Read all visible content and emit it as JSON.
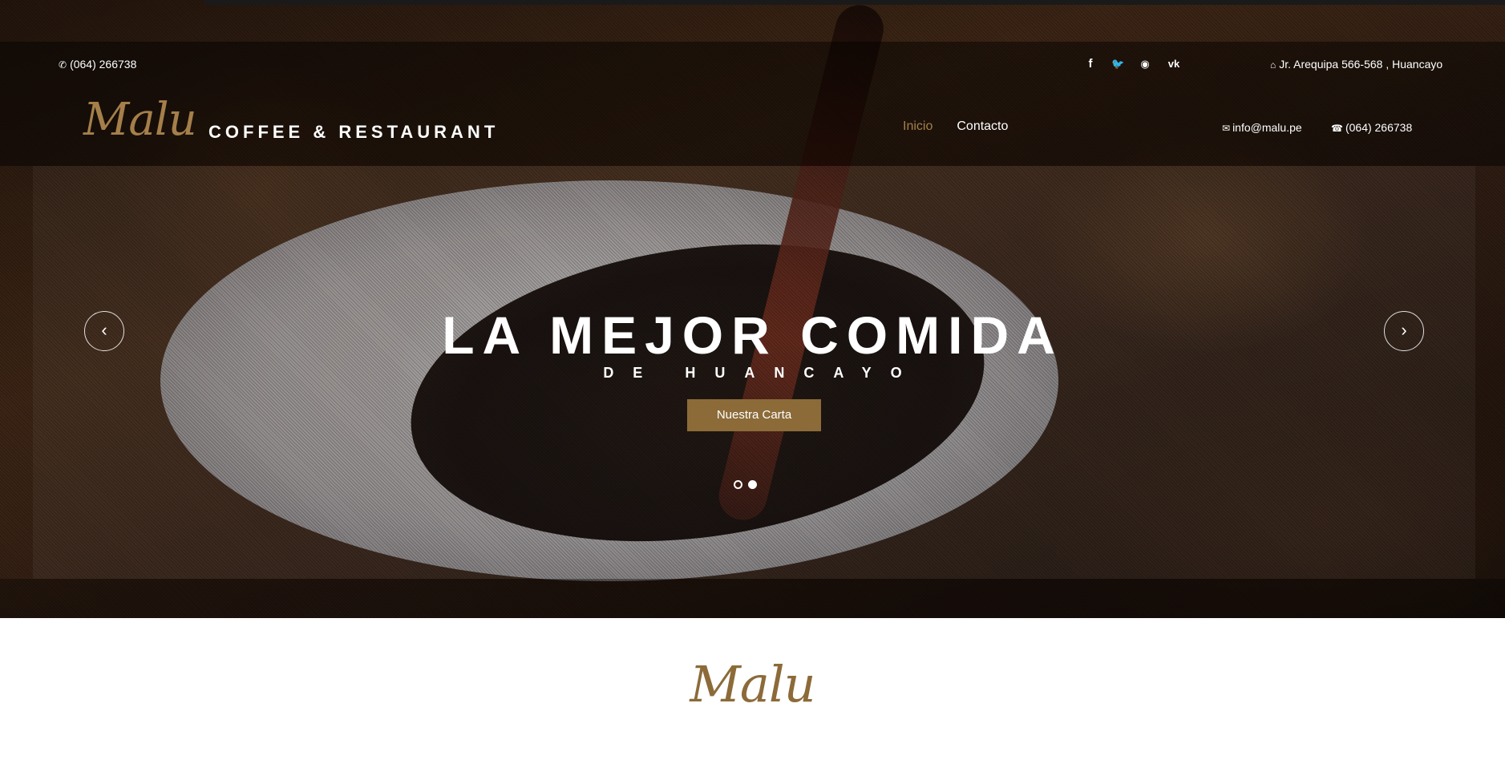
{
  "topbar": {
    "phone": "(064) 266738",
    "address": "Jr. Arequipa 566-568 , Huancayo",
    "social": [
      {
        "icon": "facebook-icon",
        "glyph": "f"
      },
      {
        "icon": "twitter-icon",
        "glyph": "🐦"
      },
      {
        "icon": "rss-icon",
        "glyph": "◉"
      },
      {
        "icon": "vk-icon",
        "glyph": "vk"
      }
    ]
  },
  "header": {
    "logo_script": "Malu",
    "logo_text": "COFFEE & RESTAURANT",
    "nav": [
      {
        "label": "Inicio",
        "active": true
      },
      {
        "label": "Contacto",
        "active": false
      }
    ],
    "email": "info@malu.pe",
    "phone": "(064) 266738"
  },
  "slider": {
    "headline": "LA MEJOR COMIDA",
    "subline": "DE HUANCAYO",
    "cta_label": "Nuestra Carta",
    "prev_glyph": "‹",
    "next_glyph": "›",
    "active_slide": 2,
    "slide_count": 2
  },
  "section": {
    "title": "Malu"
  },
  "colors": {
    "accent": "#a57f4a",
    "button": "#8c6b39"
  }
}
